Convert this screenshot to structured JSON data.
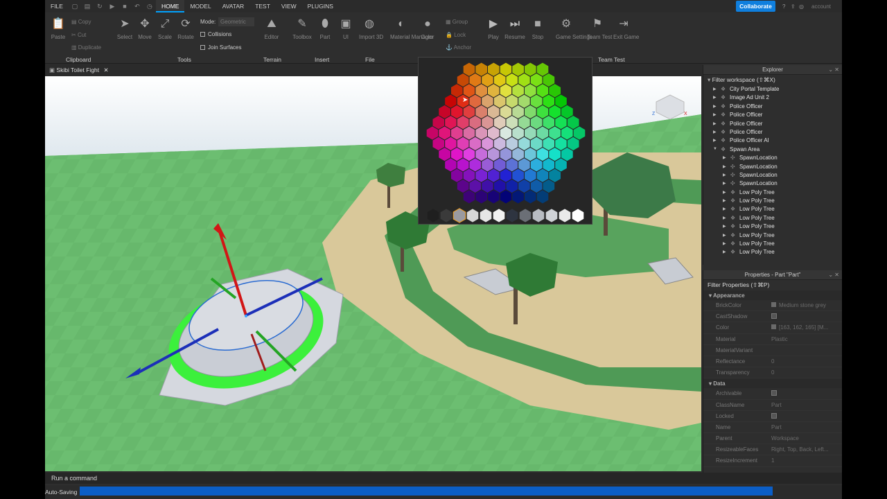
{
  "menu": {
    "file": "FILE",
    "tabs": [
      "HOME",
      "MODEL",
      "AVATAR",
      "TEST",
      "VIEW",
      "PLUGINS"
    ],
    "collaborate": "Collaborate",
    "user": "account"
  },
  "ribbon": {
    "paste": "Paste",
    "copy": "Copy",
    "cut": "Cut",
    "duplicate": "Duplicate",
    "select": "Select",
    "move": "Move",
    "scale": "Scale",
    "rotate": "Rotate",
    "mode_label": "Mode:",
    "mode_value": "Geometric",
    "collisions": "Collisions",
    "join_surfaces": "Join Surfaces",
    "editor": "Editor",
    "toolbox": "Toolbox",
    "part": "Part",
    "ui": "UI",
    "import3d": "Import 3D",
    "material_manager": "Material Manager",
    "color": "Color",
    "group": "Group",
    "lock": "Lock",
    "anchor": "Anchor",
    "play": "Play",
    "resume": "Resume",
    "stop": "Stop",
    "game_settings": "Game Settings",
    "team_test": "Team Test",
    "exit_game": "Exit Game",
    "groups": {
      "clipboard": "Clipboard",
      "tools": "Tools",
      "terrain": "Terrain",
      "insert": "Insert",
      "file": "File",
      "team_test": "Team Test"
    }
  },
  "document_tab": "Skibi Toilet Fight",
  "explorer": {
    "title": "Explorer",
    "filter": "Filter workspace (⇧⌘X)",
    "items": [
      {
        "name": "City Portal Template",
        "level": 1,
        "icon": "model-icon"
      },
      {
        "name": "Image Ad Unit 2",
        "level": 1,
        "icon": "model-icon"
      },
      {
        "name": "Police Officer",
        "level": 1,
        "icon": "model-icon"
      },
      {
        "name": "Police Officer",
        "level": 1,
        "icon": "model-icon"
      },
      {
        "name": "Police Officer",
        "level": 1,
        "icon": "model-icon"
      },
      {
        "name": "Police Officer",
        "level": 1,
        "icon": "model-icon"
      },
      {
        "name": "Police Officer AI",
        "level": 1,
        "icon": "model-icon"
      },
      {
        "name": "Spwan Area",
        "level": 1,
        "icon": "model-icon",
        "expanded": true
      },
      {
        "name": "SpawnLocation",
        "level": 2,
        "icon": "spawn-icon"
      },
      {
        "name": "SpawnLocation",
        "level": 2,
        "icon": "spawn-icon"
      },
      {
        "name": "SpawnLocation",
        "level": 2,
        "icon": "spawn-icon"
      },
      {
        "name": "SpawnLocation",
        "level": 2,
        "icon": "spawn-icon"
      },
      {
        "name": "Low Poly Tree",
        "level": 2,
        "icon": "model-icon"
      },
      {
        "name": "Low Poly Tree",
        "level": 2,
        "icon": "model-icon"
      },
      {
        "name": "Low Poly Tree",
        "level": 2,
        "icon": "model-icon"
      },
      {
        "name": "Low Poly Tree",
        "level": 2,
        "icon": "model-icon"
      },
      {
        "name": "Low Poly Tree",
        "level": 2,
        "icon": "model-icon"
      },
      {
        "name": "Low Poly Tree",
        "level": 2,
        "icon": "model-icon"
      },
      {
        "name": "Low Poly Tree",
        "level": 2,
        "icon": "model-icon"
      },
      {
        "name": "Low Poly Tree",
        "level": 2,
        "icon": "model-icon"
      }
    ]
  },
  "properties": {
    "title": "Properties - Part \"Part\"",
    "filter": "Filter Properties (⇧⌘P)",
    "sections": [
      {
        "name": "Appearance",
        "rows": [
          {
            "name": "BrickColor",
            "value": "Medium stone grey",
            "swatch": true
          },
          {
            "name": "CastShadow",
            "value": "",
            "check": true
          },
          {
            "name": "Color",
            "value": "[163, 162, 165] [M...",
            "swatch": true
          },
          {
            "name": "Material",
            "value": "Plastic"
          },
          {
            "name": "MaterialVariant",
            "value": ""
          },
          {
            "name": "Reflectance",
            "value": "0"
          },
          {
            "name": "Transparency",
            "value": "0"
          }
        ]
      },
      {
        "name": "Data",
        "rows": [
          {
            "name": "Archivable",
            "value": "",
            "check": true
          },
          {
            "name": "ClassName",
            "value": "Part"
          },
          {
            "name": "Locked",
            "value": "",
            "check": true
          },
          {
            "name": "Name",
            "value": "Part"
          },
          {
            "name": "Parent",
            "value": "Workspace"
          },
          {
            "name": "ResizeableFaces",
            "value": "Right, Top, Back, Left..."
          },
          {
            "name": "ResizeIncrement",
            "value": "1"
          }
        ]
      }
    ]
  },
  "command_bar": "Run a command",
  "status": "Auto-Saving",
  "colors": {
    "accent": "#0f7fde",
    "progress": "#0b5ec7",
    "grass": "#65b76a",
    "sky": "#e8eef1",
    "path": "#d9c89a",
    "inner_grass": "#4f9a56",
    "platform": "#c9cdd5",
    "ring_green": "#3cf03c"
  }
}
